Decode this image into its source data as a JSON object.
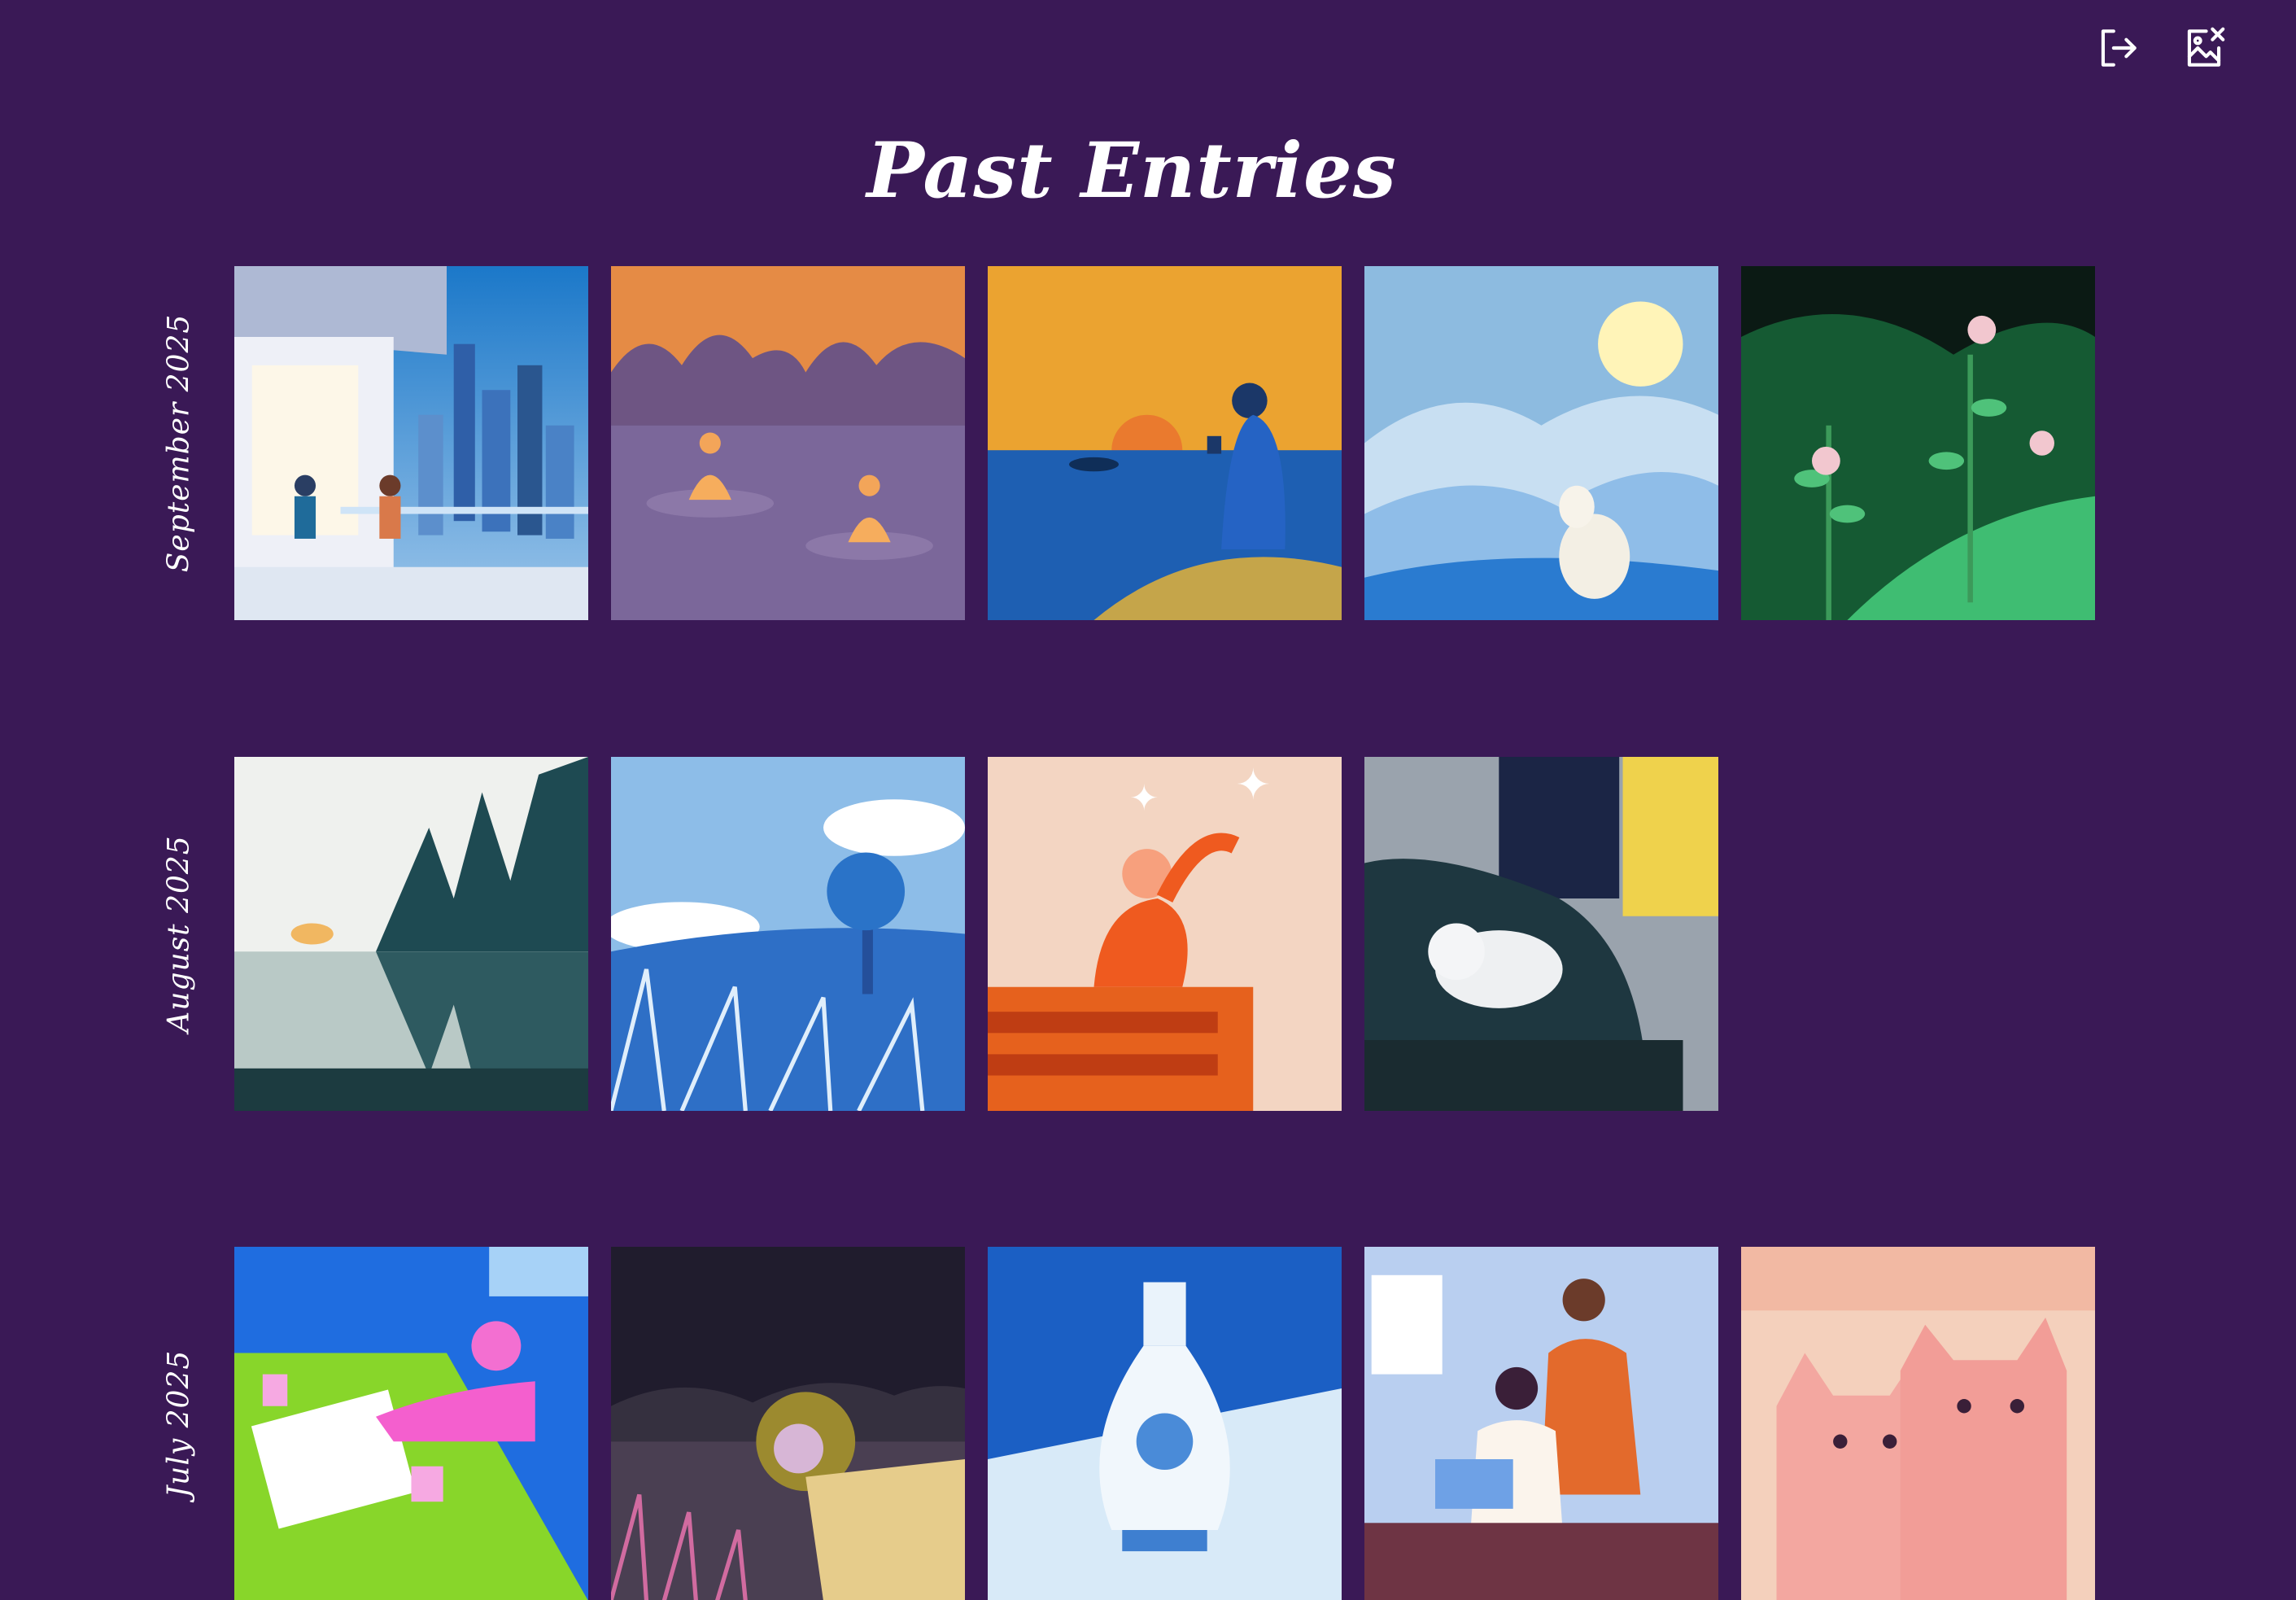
{
  "header": {
    "title": "Past Entries",
    "actions": [
      {
        "icon": "logout-icon"
      },
      {
        "icon": "image-edit-icon"
      }
    ]
  },
  "months": [
    {
      "label": "September 2025",
      "entries": [
        {
          "icon": "city-balcony-illustration"
        },
        {
          "icon": "meditation-lake-illustration"
        },
        {
          "icon": "sunset-coffee-illustration"
        },
        {
          "icon": "winter-sheep-illustration"
        },
        {
          "icon": "green-flowers-illustration"
        }
      ]
    },
    {
      "label": "August 2025",
      "entries": [
        {
          "icon": "misty-forest-lake-illustration"
        },
        {
          "icon": "blue-tree-meadow-illustration"
        },
        {
          "icon": "stretching-woman-desk-illustration"
        },
        {
          "icon": "sleeping-cat-sofa-illustration"
        }
      ]
    },
    {
      "label": "July 2025",
      "entries": [
        {
          "icon": "tired-person-desk-illustration"
        },
        {
          "icon": "lion-night-illustration"
        },
        {
          "icon": "porcelain-vase-illustration"
        },
        {
          "icon": "couple-laptop-illustration"
        },
        {
          "icon": "grumpy-cats-illustration"
        }
      ]
    }
  ]
}
